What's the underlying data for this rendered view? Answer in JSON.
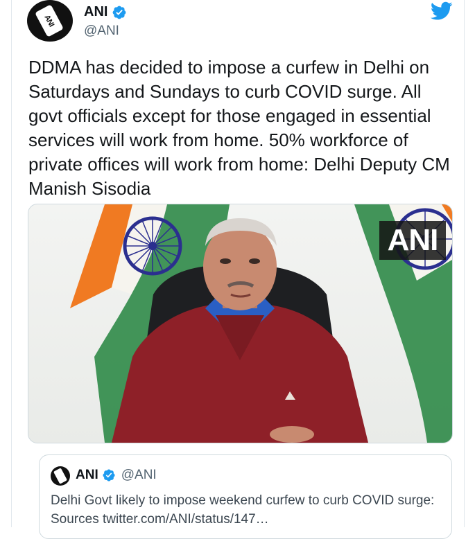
{
  "tweet": {
    "author_name": "ANI",
    "author_handle": "@ANI",
    "text": "DDMA has decided to impose a curfew in Delhi on Saturdays and Sundays to curb COVID surge. All govt officials except for those engaged in essential services will work from home. 50% workforce of private offices will work from home: Delhi Deputy CM Manish Sisodia",
    "media": {
      "watermark": "ANI"
    },
    "avatar_text": "ANI"
  },
  "quoted": {
    "author_name": "ANI",
    "author_handle": "@ANI",
    "text": "Delhi Govt likely to impose weekend curfew to curb COVID surge: Sources twitter.com/ANI/status/147…"
  },
  "icons": {
    "verified": "verified-badge-icon",
    "brand": "twitter-bird-icon"
  },
  "colors": {
    "brand_blue": "#1d9bf0",
    "saffron": "#f07a22",
    "green": "#2f8a48",
    "chakra": "#2b2f8f",
    "sweater": "#8e2028",
    "shirt": "#2a5fc4"
  }
}
